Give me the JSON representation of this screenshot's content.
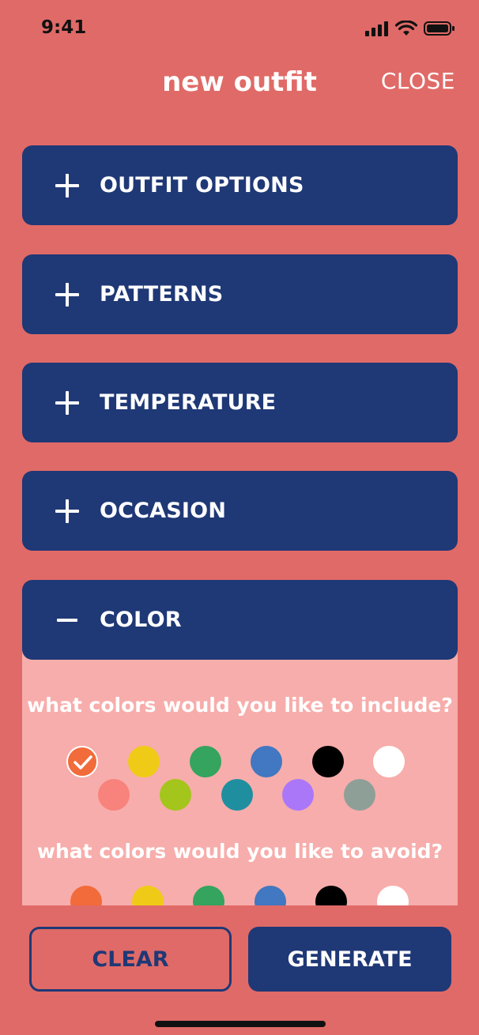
{
  "status_bar": {
    "time": "9:41"
  },
  "header": {
    "title": "new outfit",
    "close_label": "CLOSE"
  },
  "sections": [
    {
      "label": "OUTFIT OPTIONS",
      "expanded": false
    },
    {
      "label": "PATTERNS",
      "expanded": false
    },
    {
      "label": "TEMPERATURE",
      "expanded": false
    },
    {
      "label": "OCCASION",
      "expanded": false
    },
    {
      "label": "COLOR",
      "expanded": true
    }
  ],
  "color_panel": {
    "include_question": "what colors would you like to include?",
    "avoid_question": "what colors would you like to avoid?",
    "include_colors": [
      {
        "name": "orange",
        "hex": "#F26B3A",
        "selected": true
      },
      {
        "name": "yellow",
        "hex": "#EFCB17",
        "selected": false
      },
      {
        "name": "green",
        "hex": "#34A45F",
        "selected": false
      },
      {
        "name": "blue",
        "hex": "#4277C1",
        "selected": false
      },
      {
        "name": "black",
        "hex": "#000000",
        "selected": false
      },
      {
        "name": "white",
        "hex": "#FFFFFF",
        "selected": false
      },
      {
        "name": "salmon",
        "hex": "#F8827C",
        "selected": false
      },
      {
        "name": "lime",
        "hex": "#A4C51B",
        "selected": false
      },
      {
        "name": "teal",
        "hex": "#1F8FA0",
        "selected": false
      },
      {
        "name": "purple",
        "hex": "#AB77F9",
        "selected": false
      },
      {
        "name": "gray",
        "hex": "#8E9F98",
        "selected": false
      }
    ],
    "avoid_colors": [
      {
        "name": "orange",
        "hex": "#F26B3A"
      },
      {
        "name": "yellow",
        "hex": "#EFCB17"
      },
      {
        "name": "green",
        "hex": "#34A45F"
      },
      {
        "name": "blue",
        "hex": "#4277C1"
      },
      {
        "name": "black",
        "hex": "#000000"
      },
      {
        "name": "white",
        "hex": "#FFFFFF"
      }
    ]
  },
  "actions": {
    "clear_label": "CLEAR",
    "generate_label": "GENERATE"
  },
  "theme": {
    "background": "#E06A67",
    "primary": "#1F3876",
    "panel": "#F7ADAB"
  }
}
